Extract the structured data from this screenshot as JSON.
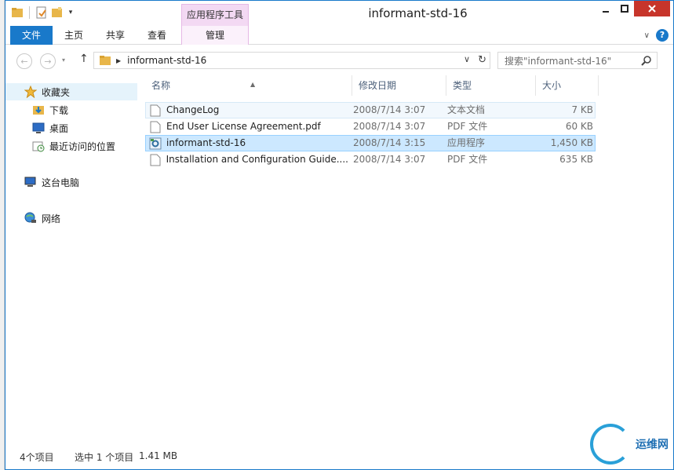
{
  "window": {
    "title": "informant-std-16",
    "context_tab": "应用程序工具"
  },
  "ribbon": {
    "tabs": [
      "文件",
      "主页",
      "共享",
      "查看",
      "管理"
    ]
  },
  "address": {
    "path": "informant-std-16",
    "search_placeholder": "搜索\"informant-std-16\""
  },
  "nav": {
    "favorites": "收藏夹",
    "downloads": "下载",
    "desktop": "桌面",
    "recent": "最近访问的位置",
    "this_pc": "这台电脑",
    "network": "网络"
  },
  "columns": {
    "name": "名称",
    "date": "修改日期",
    "type": "类型",
    "size": "大小"
  },
  "files": [
    {
      "name": "ChangeLog",
      "date": "2008/7/14 3:07",
      "type": "文本文档",
      "size": "7 KB",
      "icon": "text-file-icon"
    },
    {
      "name": "End User License Agreement.pdf",
      "date": "2008/7/14 3:07",
      "type": "PDF 文件",
      "size": "60 KB",
      "icon": "pdf-file-icon"
    },
    {
      "name": "informant-std-16",
      "date": "2008/7/14 3:15",
      "type": "应用程序",
      "size": "1,450 KB",
      "icon": "exe-file-icon"
    },
    {
      "name": "Installation and Configuration Guide....",
      "date": "2008/7/14 3:07",
      "type": "PDF 文件",
      "size": "635 KB",
      "icon": "pdf-file-icon"
    }
  ],
  "status": {
    "item_count": "4个项目",
    "selected": "选中 1 个项目",
    "size": "1.41 MB"
  },
  "watermark": {
    "site": "运维网"
  },
  "colors": {
    "accent": "#1979ca",
    "selection": "#cce8ff",
    "context_tab": "#f3d9f3",
    "close_button": "#c7352b"
  }
}
